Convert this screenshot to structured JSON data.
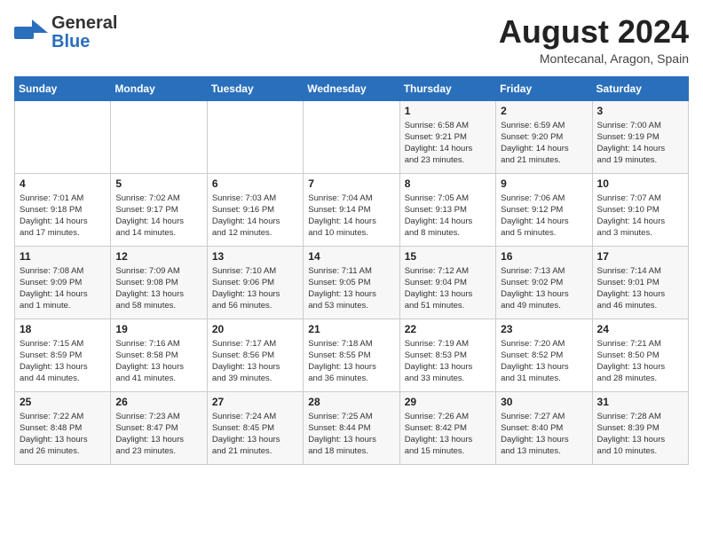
{
  "header": {
    "logo_line1": "General",
    "logo_line2": "Blue",
    "month_year": "August 2024",
    "location": "Montecanal, Aragon, Spain"
  },
  "weekdays": [
    "Sunday",
    "Monday",
    "Tuesday",
    "Wednesday",
    "Thursday",
    "Friday",
    "Saturday"
  ],
  "weeks": [
    [
      {
        "day": "",
        "detail": ""
      },
      {
        "day": "",
        "detail": ""
      },
      {
        "day": "",
        "detail": ""
      },
      {
        "day": "",
        "detail": ""
      },
      {
        "day": "1",
        "detail": "Sunrise: 6:58 AM\nSunset: 9:21 PM\nDaylight: 14 hours\nand 23 minutes."
      },
      {
        "day": "2",
        "detail": "Sunrise: 6:59 AM\nSunset: 9:20 PM\nDaylight: 14 hours\nand 21 minutes."
      },
      {
        "day": "3",
        "detail": "Sunrise: 7:00 AM\nSunset: 9:19 PM\nDaylight: 14 hours\nand 19 minutes."
      }
    ],
    [
      {
        "day": "4",
        "detail": "Sunrise: 7:01 AM\nSunset: 9:18 PM\nDaylight: 14 hours\nand 17 minutes."
      },
      {
        "day": "5",
        "detail": "Sunrise: 7:02 AM\nSunset: 9:17 PM\nDaylight: 14 hours\nand 14 minutes."
      },
      {
        "day": "6",
        "detail": "Sunrise: 7:03 AM\nSunset: 9:16 PM\nDaylight: 14 hours\nand 12 minutes."
      },
      {
        "day": "7",
        "detail": "Sunrise: 7:04 AM\nSunset: 9:14 PM\nDaylight: 14 hours\nand 10 minutes."
      },
      {
        "day": "8",
        "detail": "Sunrise: 7:05 AM\nSunset: 9:13 PM\nDaylight: 14 hours\nand 8 minutes."
      },
      {
        "day": "9",
        "detail": "Sunrise: 7:06 AM\nSunset: 9:12 PM\nDaylight: 14 hours\nand 5 minutes."
      },
      {
        "day": "10",
        "detail": "Sunrise: 7:07 AM\nSunset: 9:10 PM\nDaylight: 14 hours\nand 3 minutes."
      }
    ],
    [
      {
        "day": "11",
        "detail": "Sunrise: 7:08 AM\nSunset: 9:09 PM\nDaylight: 14 hours\nand 1 minute."
      },
      {
        "day": "12",
        "detail": "Sunrise: 7:09 AM\nSunset: 9:08 PM\nDaylight: 13 hours\nand 58 minutes."
      },
      {
        "day": "13",
        "detail": "Sunrise: 7:10 AM\nSunset: 9:06 PM\nDaylight: 13 hours\nand 56 minutes."
      },
      {
        "day": "14",
        "detail": "Sunrise: 7:11 AM\nSunset: 9:05 PM\nDaylight: 13 hours\nand 53 minutes."
      },
      {
        "day": "15",
        "detail": "Sunrise: 7:12 AM\nSunset: 9:04 PM\nDaylight: 13 hours\nand 51 minutes."
      },
      {
        "day": "16",
        "detail": "Sunrise: 7:13 AM\nSunset: 9:02 PM\nDaylight: 13 hours\nand 49 minutes."
      },
      {
        "day": "17",
        "detail": "Sunrise: 7:14 AM\nSunset: 9:01 PM\nDaylight: 13 hours\nand 46 minutes."
      }
    ],
    [
      {
        "day": "18",
        "detail": "Sunrise: 7:15 AM\nSunset: 8:59 PM\nDaylight: 13 hours\nand 44 minutes."
      },
      {
        "day": "19",
        "detail": "Sunrise: 7:16 AM\nSunset: 8:58 PM\nDaylight: 13 hours\nand 41 minutes."
      },
      {
        "day": "20",
        "detail": "Sunrise: 7:17 AM\nSunset: 8:56 PM\nDaylight: 13 hours\nand 39 minutes."
      },
      {
        "day": "21",
        "detail": "Sunrise: 7:18 AM\nSunset: 8:55 PM\nDaylight: 13 hours\nand 36 minutes."
      },
      {
        "day": "22",
        "detail": "Sunrise: 7:19 AM\nSunset: 8:53 PM\nDaylight: 13 hours\nand 33 minutes."
      },
      {
        "day": "23",
        "detail": "Sunrise: 7:20 AM\nSunset: 8:52 PM\nDaylight: 13 hours\nand 31 minutes."
      },
      {
        "day": "24",
        "detail": "Sunrise: 7:21 AM\nSunset: 8:50 PM\nDaylight: 13 hours\nand 28 minutes."
      }
    ],
    [
      {
        "day": "25",
        "detail": "Sunrise: 7:22 AM\nSunset: 8:48 PM\nDaylight: 13 hours\nand 26 minutes."
      },
      {
        "day": "26",
        "detail": "Sunrise: 7:23 AM\nSunset: 8:47 PM\nDaylight: 13 hours\nand 23 minutes."
      },
      {
        "day": "27",
        "detail": "Sunrise: 7:24 AM\nSunset: 8:45 PM\nDaylight: 13 hours\nand 21 minutes."
      },
      {
        "day": "28",
        "detail": "Sunrise: 7:25 AM\nSunset: 8:44 PM\nDaylight: 13 hours\nand 18 minutes."
      },
      {
        "day": "29",
        "detail": "Sunrise: 7:26 AM\nSunset: 8:42 PM\nDaylight: 13 hours\nand 15 minutes."
      },
      {
        "day": "30",
        "detail": "Sunrise: 7:27 AM\nSunset: 8:40 PM\nDaylight: 13 hours\nand 13 minutes."
      },
      {
        "day": "31",
        "detail": "Sunrise: 7:28 AM\nSunset: 8:39 PM\nDaylight: 13 hours\nand 10 minutes."
      }
    ]
  ]
}
